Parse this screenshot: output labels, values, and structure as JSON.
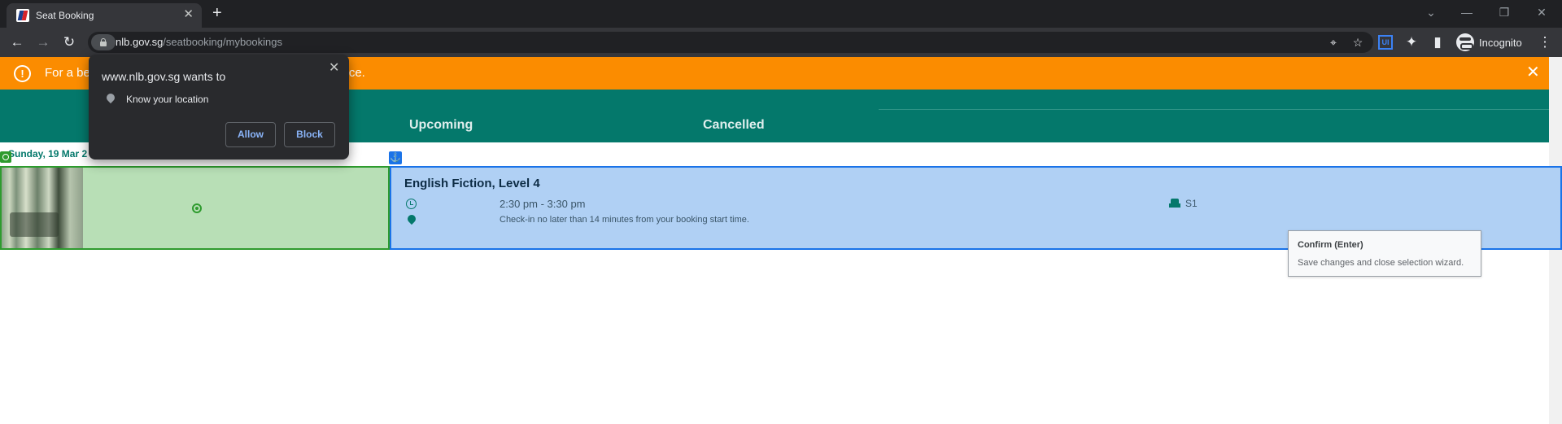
{
  "browser": {
    "tab_title": "Seat Booking",
    "url_host": "nlb.gov.sg",
    "url_path": "/seatbooking/mybookings",
    "profile_label": "Incognito",
    "ext_label": "UI"
  },
  "permission_prompt": {
    "title": "www.nlb.gov.sg wants to",
    "request": "Know your location",
    "allow_label": "Allow",
    "block_label": "Block"
  },
  "banner": {
    "text_start": "For a be",
    "text_end": "vice."
  },
  "tabs": {
    "upcoming": "Upcoming",
    "cancelled": "Cancelled"
  },
  "booking": {
    "date": "Sunday, 19 Mar 2",
    "location": "English Fiction, Level 4",
    "time": "2:30 pm - 3:30 pm",
    "checkin_note": "Check-in no later than 14 minutes from your booking start time.",
    "seat": "S1"
  },
  "tooltip": {
    "title": "Confirm (Enter)",
    "description": "Save changes and close selection wizard."
  },
  "colors": {
    "teal": "#04786b",
    "orange": "#fb8c00",
    "selection_green": "#2e9b2e",
    "selection_blue": "#1a73e8"
  }
}
